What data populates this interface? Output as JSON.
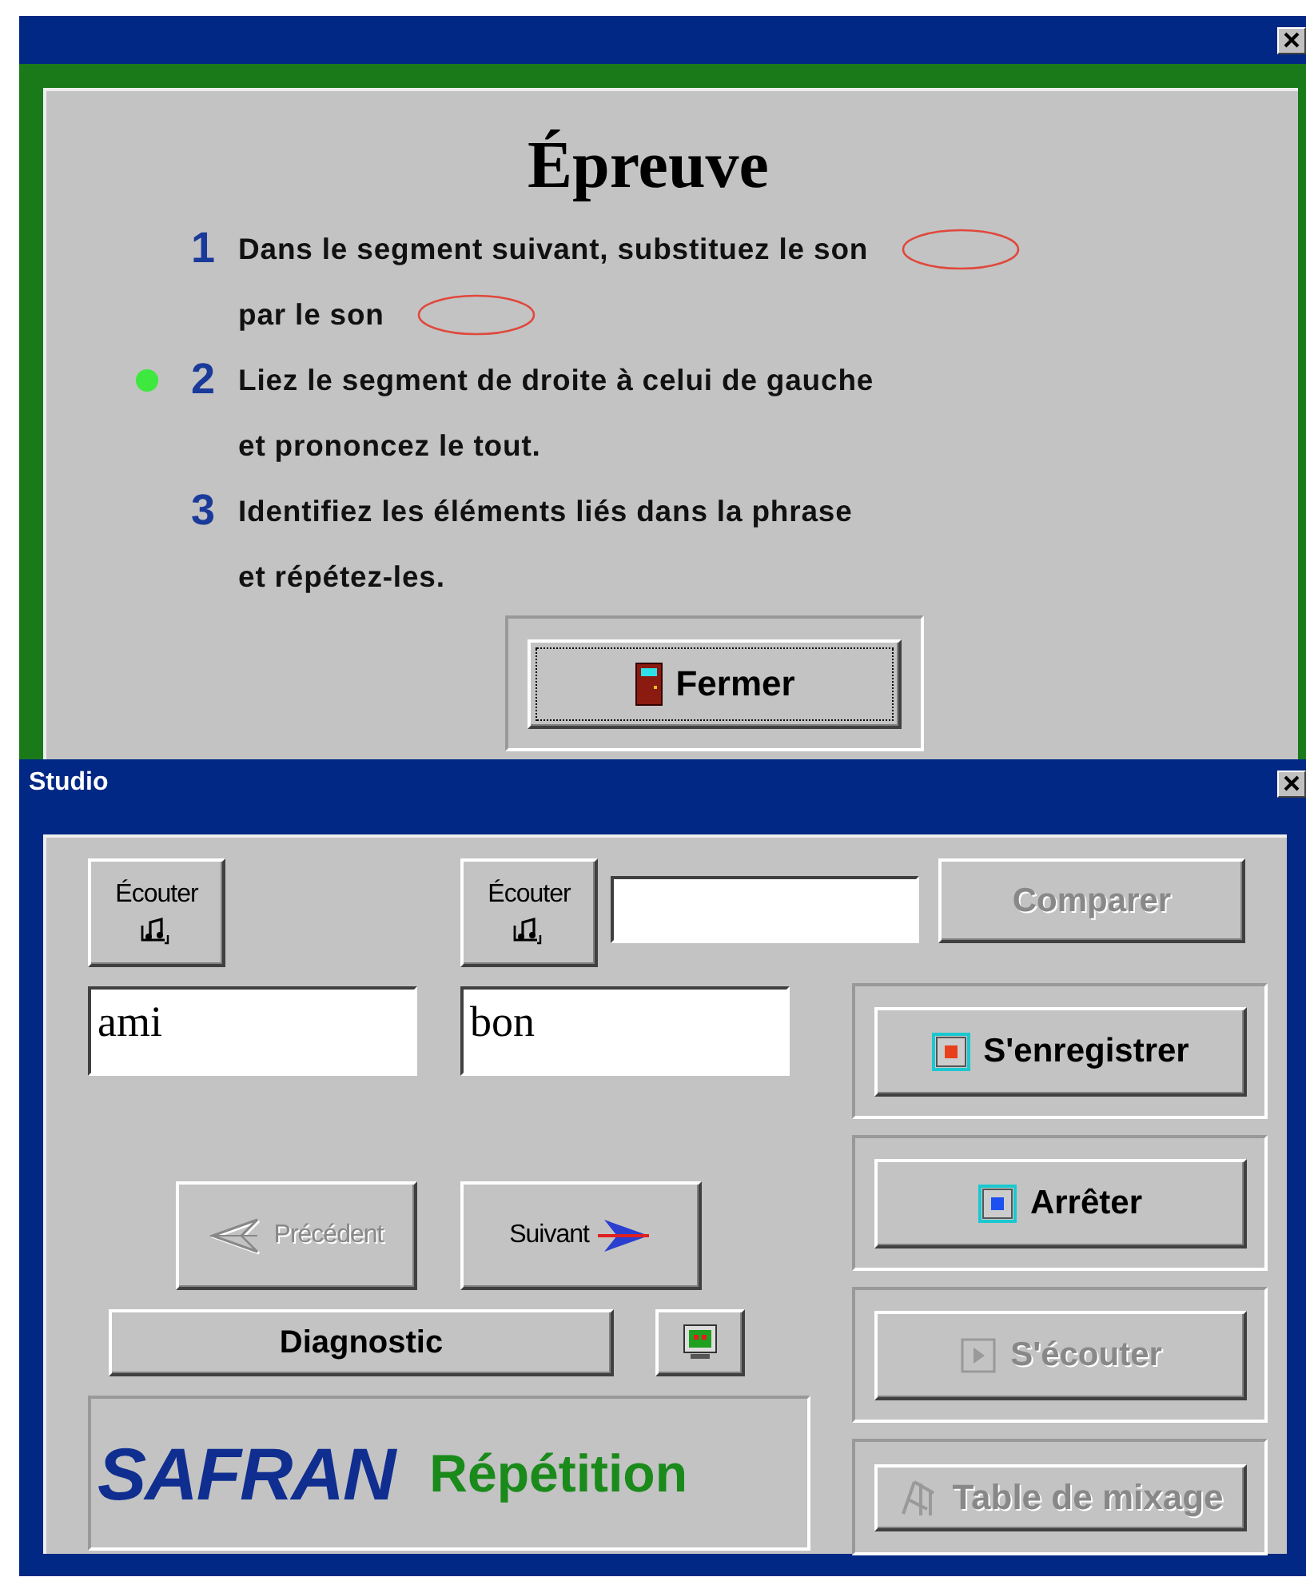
{
  "epreuve_window": {
    "title": "Épreuve",
    "steps": [
      {
        "number": "1",
        "active": false,
        "lines": [
          {
            "text": "Dans le segment suivant, substituez le son",
            "blank": true
          },
          {
            "text": "par le son",
            "blank": true
          }
        ]
      },
      {
        "number": "2",
        "active": true,
        "lines": [
          {
            "text": "Liez le segment de droite à celui de gauche",
            "blank": false
          },
          {
            "text": "et prononcez le tout.",
            "blank": false
          }
        ]
      },
      {
        "number": "3",
        "active": false,
        "lines": [
          {
            "text": "Identifiez les éléments liés dans la phrase",
            "blank": false
          },
          {
            "text": "et répétez-les.",
            "blank": false
          }
        ]
      }
    ],
    "close_button": {
      "label": "Fermer",
      "focused": true
    }
  },
  "studio_window": {
    "title": "Studio",
    "listen_buttons": [
      {
        "label": "Écouter"
      },
      {
        "label": "Écouter"
      }
    ],
    "word_fields": [
      {
        "value": "ami"
      },
      {
        "value": "bon"
      }
    ],
    "compare_button": {
      "label": "Comparer",
      "disabled": true
    },
    "nav_buttons": [
      {
        "kind": "previous",
        "label": "Précédent",
        "disabled": true
      },
      {
        "kind": "next",
        "label": "Suivant",
        "disabled": false
      }
    ],
    "diagnostic_button": {
      "label": "Diagnostic"
    },
    "logo": {
      "brand": "SAFRAN",
      "product": "Répétition"
    },
    "actions": [
      {
        "kind": "record",
        "label": "S'enregistrer",
        "disabled": false
      },
      {
        "kind": "stop",
        "label": "Arrêter",
        "disabled": false
      },
      {
        "kind": "play",
        "label": "S'écouter",
        "disabled": true
      },
      {
        "kind": "mixer",
        "label": "Table de mixage",
        "disabled": true
      }
    ]
  }
}
